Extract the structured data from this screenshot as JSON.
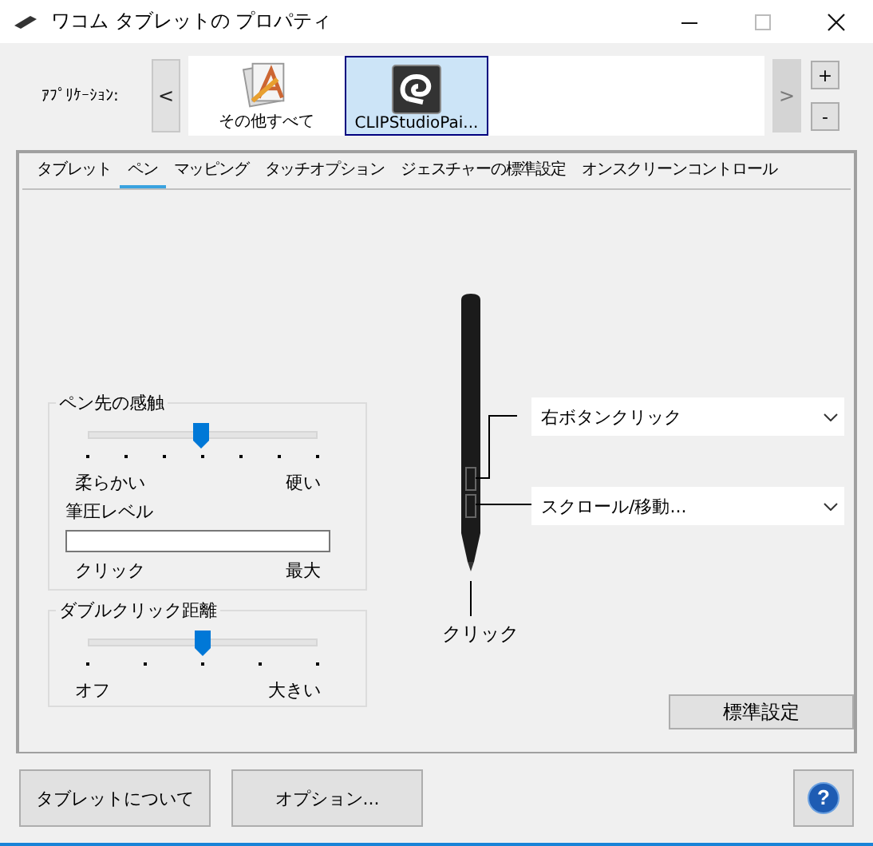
{
  "window": {
    "title": "ワコム タブレットの プロパティ"
  },
  "applications": {
    "label": "ｱﾌﾟﾘｹｰｼｮﾝ:",
    "prev": {
      "label": "<",
      "disabled": false
    },
    "next": {
      "label": ">",
      "disabled": true
    },
    "add": "+",
    "remove": "-",
    "items": [
      {
        "name": "その他すべて",
        "kind": "all",
        "selected": false
      },
      {
        "name": "CLIPStudioPai...",
        "kind": "clip",
        "selected": true
      }
    ]
  },
  "tabs": [
    {
      "label": "タブレット",
      "selected": false
    },
    {
      "label": "ペン",
      "selected": true
    },
    {
      "label": "マッピング",
      "selected": false
    },
    {
      "label": "タッチオプション",
      "selected": false
    },
    {
      "label": "ジェスチャーの標準設定",
      "selected": false
    },
    {
      "label": "オンスクリーンコントロール",
      "selected": false
    }
  ],
  "tip_feel": {
    "title": "ペン先の感触",
    "slider": {
      "level": 0.49,
      "min_label": "柔らかい",
      "max_label": "硬い"
    },
    "pressure": {
      "label": "筆圧レベル",
      "min_label": "クリック",
      "max_label": "最大"
    }
  },
  "double_click": {
    "title": "ダブルクリック距離",
    "slider": {
      "level": 0.5,
      "min_label": "オフ",
      "max_label": "大きい"
    }
  },
  "pen": {
    "upper_button": "右ボタンクリック",
    "lower_button": "スクロール/移動...",
    "tip": "クリック"
  },
  "default_button": "標準設定",
  "footer": {
    "about": "タブレットについて",
    "options": "オプション...",
    "help": "?"
  }
}
